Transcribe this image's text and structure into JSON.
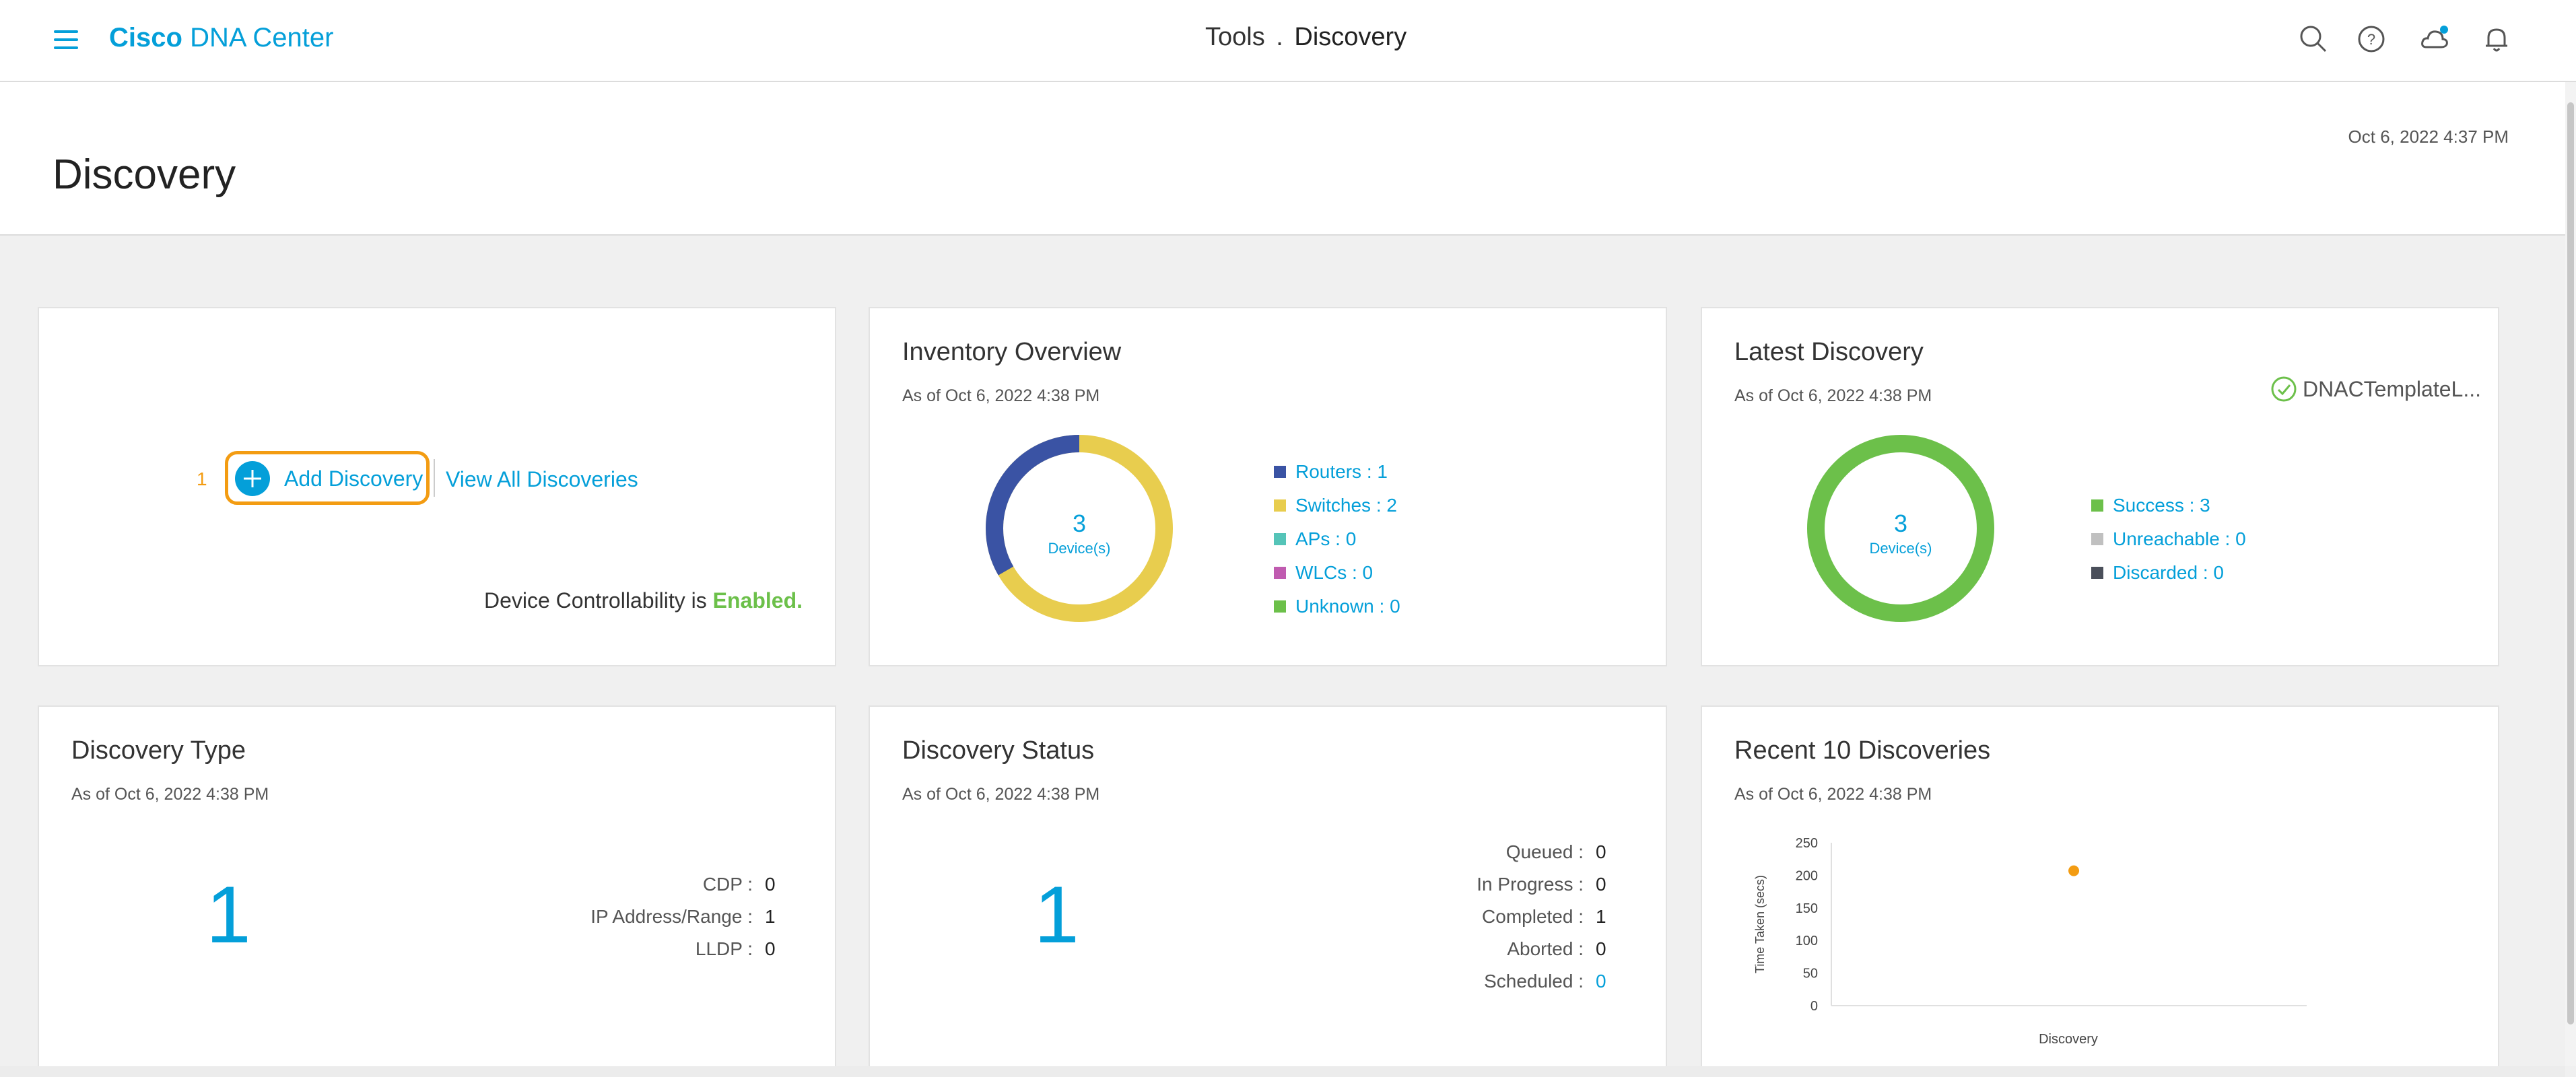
{
  "header": {
    "brand_bold": "Cisco",
    "brand_rest": "DNA Center",
    "breadcrumb_parent": "Tools",
    "breadcrumb_sep": ".",
    "breadcrumb_current": "Discovery",
    "icons": [
      "search-icon",
      "help-icon",
      "cloud-notification-icon",
      "bell-icon"
    ],
    "accent": "#049fd9"
  },
  "page": {
    "title": "Discovery",
    "timestamp": "Oct 6, 2022 4:37 PM"
  },
  "add_card": {
    "step_number": "1",
    "add_button_label": "Add Discovery",
    "view_all_label": "View All Discoveries",
    "controllability_text": "Device Controllability is",
    "controllability_status": "Enabled.",
    "status_color": "#6cc04a",
    "highlight_color": "#f39c12"
  },
  "inventory": {
    "title": "Inventory Overview",
    "subtitle": "As of Oct 6, 2022 4:38 PM",
    "total": "3",
    "total_label": "Device(s)",
    "segments": [
      {
        "label": "Routers : 1",
        "value": 1,
        "color": "#3a53a4"
      },
      {
        "label": "Switches : 2",
        "value": 2,
        "color": "#e8cd4e"
      },
      {
        "label": "APs : 0",
        "value": 0,
        "color": "#55c4b8"
      },
      {
        "label": "WLCs : 0",
        "value": 0,
        "color": "#c05bb0"
      },
      {
        "label": "Unknown : 0",
        "value": 0,
        "color": "#6cc04a"
      }
    ]
  },
  "latest": {
    "title": "Latest Discovery",
    "subtitle": "As of Oct 6, 2022 4:38 PM",
    "discovery_name": "DNACTemplateL...",
    "total": "3",
    "total_label": "Device(s)",
    "segments": [
      {
        "label": "Success : 3",
        "value": 3,
        "color": "#6cc04a"
      },
      {
        "label": "Unreachable : 0",
        "value": 0,
        "color": "#c0c0c0"
      },
      {
        "label": "Discarded : 0",
        "value": 0,
        "color": "#4a4f5a"
      }
    ]
  },
  "type_card": {
    "title": "Discovery Type",
    "subtitle": "As of Oct 6, 2022 4:38 PM",
    "total": "1",
    "rows": [
      {
        "key": "CDP :",
        "value": "0"
      },
      {
        "key": "IP Address/Range :",
        "value": "1"
      },
      {
        "key": "LLDP :",
        "value": "0"
      }
    ]
  },
  "status_card": {
    "title": "Discovery Status",
    "subtitle": "As of Oct 6, 2022 4:38 PM",
    "total": "1",
    "rows": [
      {
        "key": "Queued :",
        "value": "0"
      },
      {
        "key": "In Progress :",
        "value": "0"
      },
      {
        "key": "Completed :",
        "value": "1"
      },
      {
        "key": "Aborted :",
        "value": "0"
      },
      {
        "key": "Scheduled :",
        "value": "0"
      }
    ]
  },
  "recent": {
    "title": "Recent 10 Discoveries",
    "subtitle": "As of Oct 6, 2022 4:38 PM"
  },
  "chart_data": {
    "type": "scatter",
    "title": "",
    "xlabel": "Discovery",
    "ylabel": "Time Taken (secs)",
    "y_ticks": [
      "250",
      "200",
      "150",
      "100",
      "50",
      "0"
    ],
    "ylim": [
      0,
      250
    ],
    "series": [
      {
        "points": [
          {
            "x": 1,
            "y": 207
          }
        ],
        "color": "#f39c12"
      }
    ]
  }
}
